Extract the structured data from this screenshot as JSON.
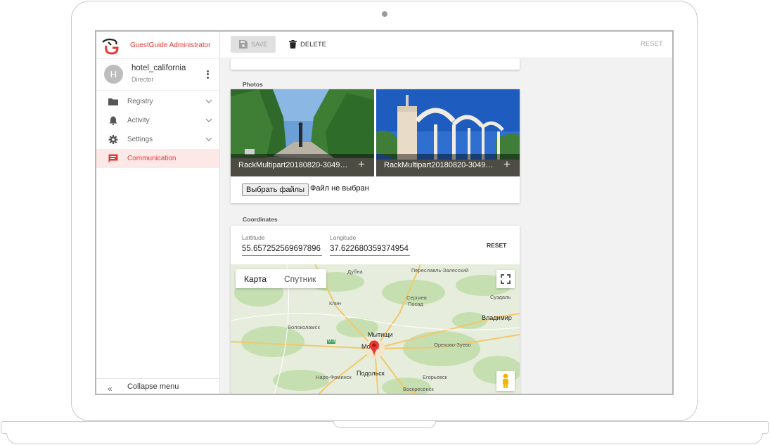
{
  "app": {
    "brand_title": "GuestGuide Administrator"
  },
  "user": {
    "avatar_letter": "H",
    "name": "hotel_california",
    "role": "Director"
  },
  "sidebar": {
    "items": [
      {
        "label": "Registry",
        "icon": "folder-icon",
        "has_chevron": true,
        "active": false
      },
      {
        "label": "Activity",
        "icon": "bell-icon",
        "has_chevron": true,
        "active": false
      },
      {
        "label": "Settings",
        "icon": "gear-icon",
        "has_chevron": true,
        "active": false
      },
      {
        "label": "Communication",
        "icon": "chat-icon",
        "has_chevron": false,
        "active": true
      }
    ],
    "collapse_icon": "«",
    "collapse_label": "Collapse menu"
  },
  "toolbar": {
    "save_label": "SAVE",
    "delete_label": "DELETE",
    "reset_label": "RESET"
  },
  "photos": {
    "section_label": "Photos",
    "items": [
      {
        "name": "RackMultipart20180820-3049…",
        "add_icon": "+"
      },
      {
        "name": "RackMultipart20180820-3049…",
        "add_icon": "+"
      }
    ],
    "file_button": "Выбрать файлы",
    "file_status": "Файл не выбран"
  },
  "coordinates": {
    "section_label": "Coordinates",
    "latitude_label": "Lattitude",
    "latitude_value": "55.657252569697896",
    "longitude_label": "Longitude",
    "longitude_value": "37.622680359374954",
    "reset_label": "RESET"
  },
  "map": {
    "tab_map": "Карта",
    "tab_satellite": "Спутник",
    "labels": {
      "dubna": "Дубна",
      "pereslavl": "Переславль-Залесский",
      "sergiev": "Сергиев",
      "posad": "Посад",
      "suzdal": "Суздаль",
      "klin": "Клин",
      "vladimir": "Владимир",
      "volokolamsk": "Волоколамск",
      "mytishchi": "Мытищи",
      "moskva": "Мо    ва",
      "orekhovo": "Орехово-Зуево",
      "podolsk": "Подольск",
      "naro": "Наро-Фоминск",
      "egorievsk": "Егорьевск",
      "voskresensk": "Воскресенск",
      "road_m9": "М-9"
    },
    "colors": {
      "land": "#e6eddc",
      "forest": "#c6dfb1",
      "road": "#f2c86b",
      "pin": "#e53935"
    }
  },
  "colors": {
    "accent": "#e53935",
    "active_bg": "#fde8e8"
  }
}
